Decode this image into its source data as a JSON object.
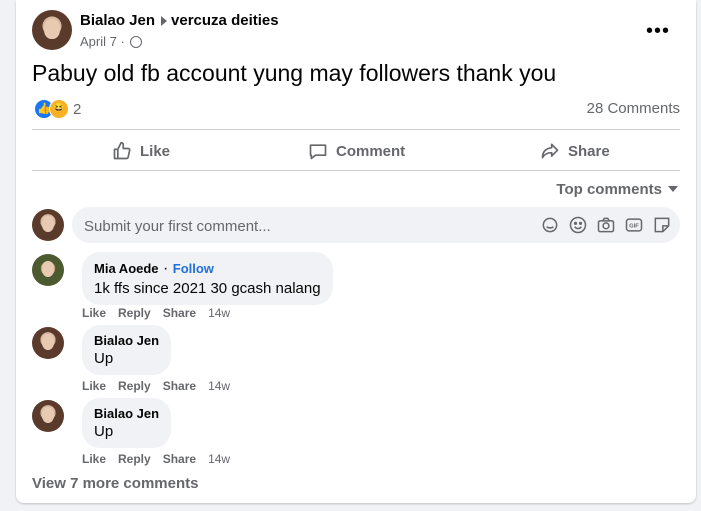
{
  "post": {
    "author": "Bialao Jen",
    "group": "vercuza deities",
    "date": "April 7",
    "text": "Pabuy old fb account yung may followers thank you",
    "reaction_count": "2",
    "comments_count": "28 Comments",
    "more_icon": "•••"
  },
  "actions": {
    "like": "Like",
    "comment": "Comment",
    "share": "Share"
  },
  "sort_label": "Top comments",
  "comment_input": {
    "placeholder": "Submit your first comment..."
  },
  "comments": [
    {
      "name": "Mia Aoede",
      "follow": "Follow",
      "text": "1k ffs since 2021 30 gcash nalang",
      "like": "Like",
      "reply": "Reply",
      "share": "Share",
      "time": "14w"
    },
    {
      "name": "Bialao Jen",
      "text": "Up",
      "like": "Like",
      "reply": "Reply",
      "share": "Share",
      "time": "14w"
    },
    {
      "name": "Bialao Jen",
      "text": "Up",
      "like": "Like",
      "reply": "Reply",
      "share": "Share",
      "time": "14w"
    }
  ],
  "view_more": "View 7 more comments",
  "colors": {
    "accent": "#1877f2",
    "follow_link": "#216fdb",
    "secondary_text": "#65676b",
    "bubble": "#f0f2f5"
  },
  "icons": {
    "reactions": [
      "like-reaction-icon",
      "haha-reaction-icon"
    ],
    "actions": [
      "thumbs-up-icon",
      "comment-icon",
      "share-arrow-icon"
    ],
    "composer": [
      "avatar-sticker-icon",
      "emoji-icon",
      "camera-icon",
      "gif-icon",
      "sticker-icon"
    ]
  }
}
